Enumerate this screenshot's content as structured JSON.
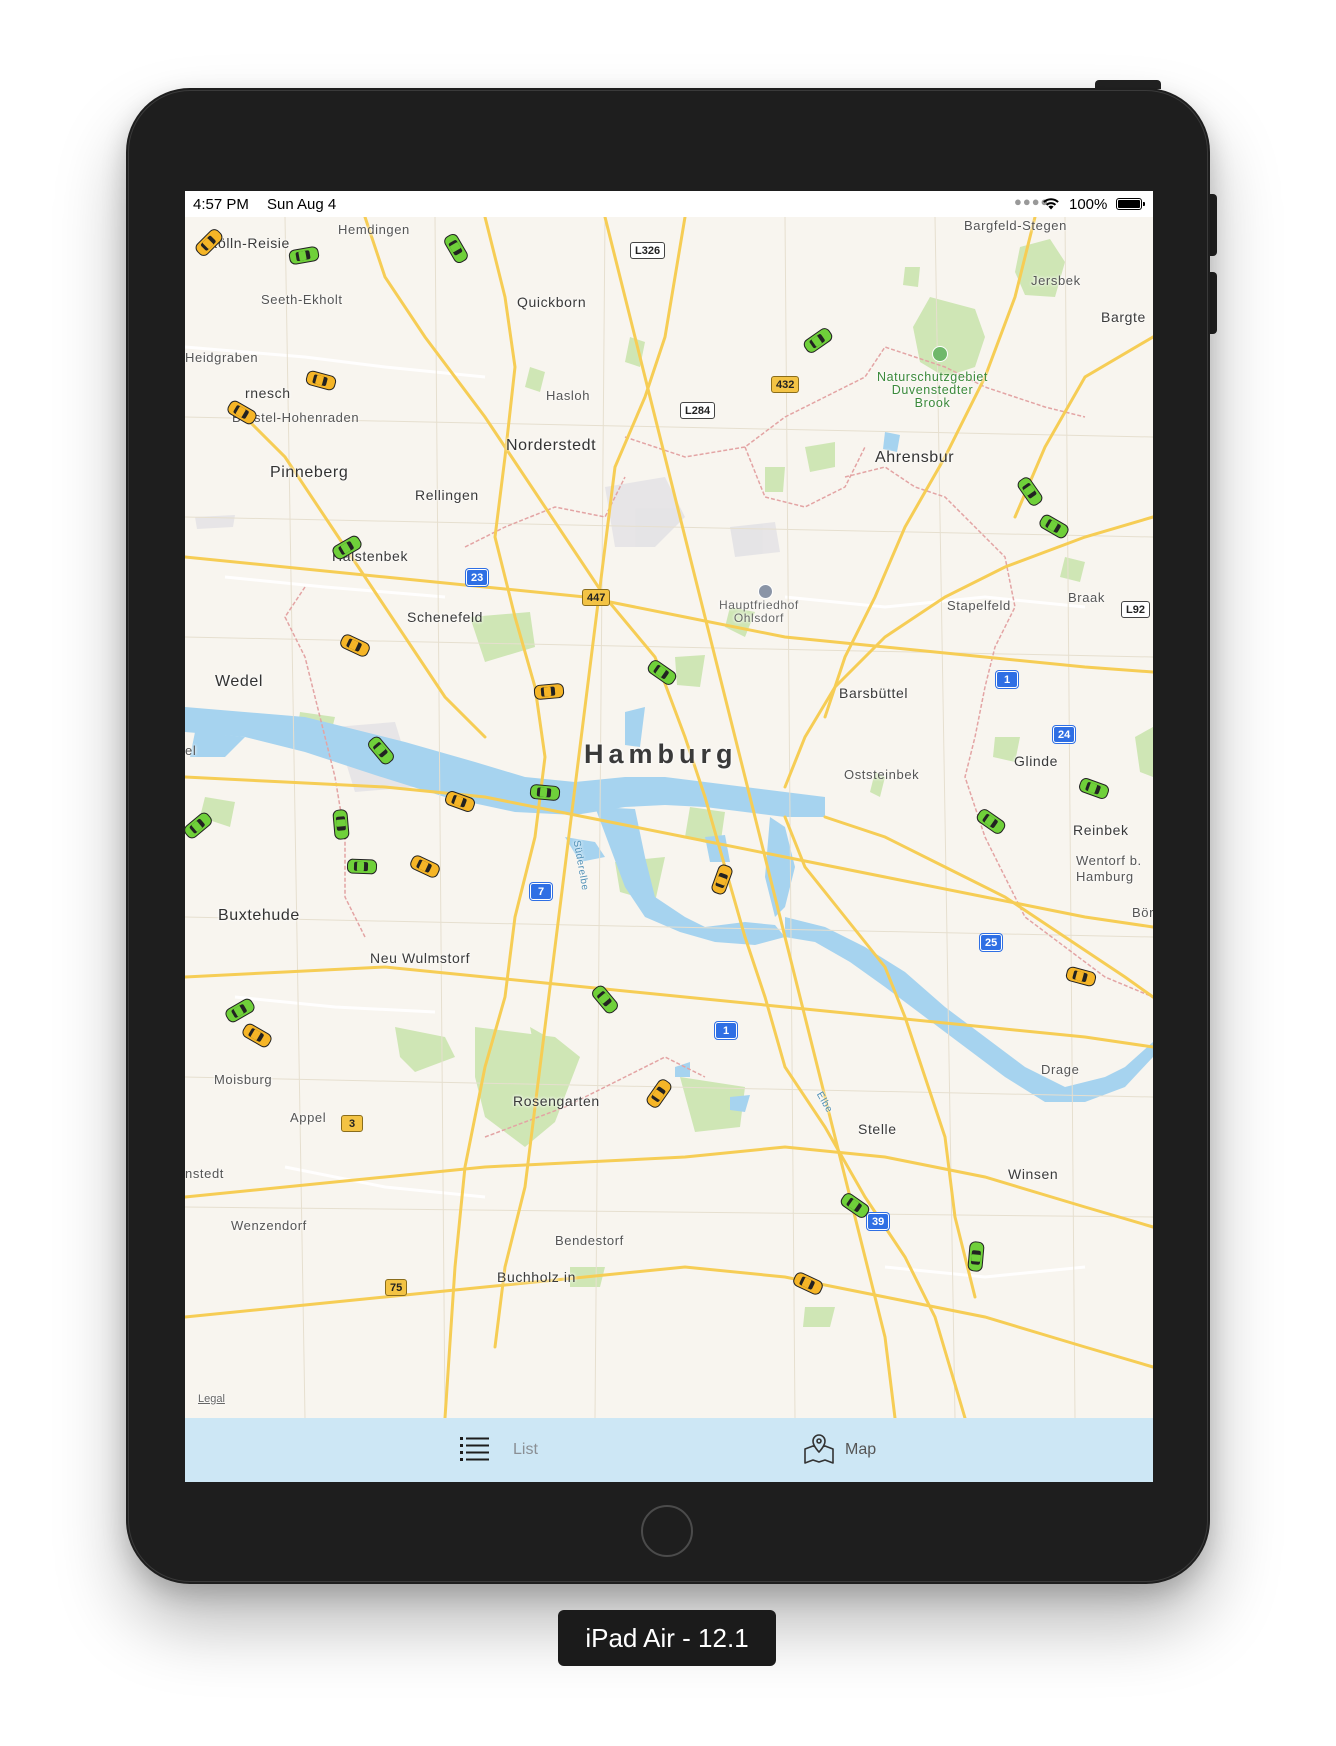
{
  "status_bar": {
    "time": "4:57 PM",
    "date": "Sun Aug 4",
    "battery": "100%"
  },
  "map": {
    "city": "Hamburg",
    "places": {
      "kolln_reisiek": "Kölln-Reisie",
      "hemdingen": "Hemdingen",
      "bargfeld_stegen": "Bargfeld-Stegen",
      "jersbek": "Jersbek",
      "bargteheide": "Bargte",
      "seeth_ekholt": "Seeth-Ekholt",
      "quickborn": "Quickborn",
      "heidgraben": "Heidgraben",
      "ellerau_rnesch": "rnesch",
      "borstel_hohenraden": "Borstel-Hohenraden",
      "hasloh": "Hasloh",
      "norderstedt": "Norderstedt",
      "ahrensburg": "Ahrensbur",
      "pinneberg": "Pinneberg",
      "rellingen": "Rellingen",
      "halstenbek": "Halstenbek",
      "schenefeld": "Schenefeld",
      "stapelfeld": "Stapelfeld",
      "braak": "Braak",
      "wedel": "Wedel",
      "barsbuettel": "Barsbüttel",
      "glinde": "Glinde",
      "oststeinbek": "Oststeinbek",
      "reinbek": "Reinbek",
      "wentorf": "Wentorf b.\nHamburg",
      "boernsen": "Bör",
      "buxtehude": "Buxtehude",
      "neu_wulmstorf": "Neu Wulmstorf",
      "drage": "Drage",
      "moisburg": "Moisburg",
      "appel": "Appel",
      "rosengarten": "Rosengarten",
      "stelle": "Stelle",
      "winsen": "Winsen",
      "hollenstedt": "nstedt",
      "wenzendorf": "Wenzendorf",
      "bendestorf": "Bendestorf",
      "buchholz": "Buchholz in",
      "el": "el"
    },
    "park": "Naturschutzgebiet\nDuvenstedter\nBrook",
    "poi": "Hauptfriedhof\nOhlsdorf",
    "river_suderelbe": "Süderelbe",
    "river_elbe": "Elbe",
    "legal": "Legal",
    "roads": {
      "l326": "L326",
      "l284": "L284",
      "r432": "432",
      "r447": "447",
      "a23": "23",
      "l92": "L92",
      "a1_north": "1",
      "a24": "24",
      "a7": "7",
      "a25": "25",
      "a1_south": "1",
      "r3": "3",
      "a39": "39",
      "r75": "75"
    }
  },
  "tabbar": {
    "list_label": "List",
    "map_label": "Map"
  },
  "simulator_label": "iPad Air - 12.1",
  "colors": {
    "taxi_green": "#6fd03a",
    "taxi_yellow": "#f5b527",
    "tabbar_bg": "#cde7f5",
    "water": "#a6d3ef",
    "road": "#f6cd55"
  }
}
